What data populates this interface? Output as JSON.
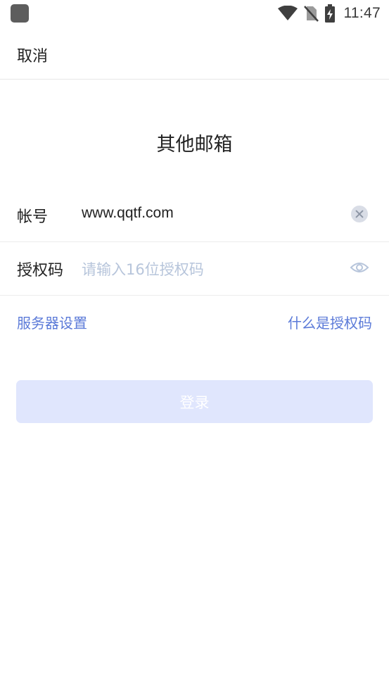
{
  "status_bar": {
    "time": "11:47",
    "icons": [
      "app-badge",
      "wifi-icon",
      "no-sim-icon",
      "battery-charging-icon"
    ]
  },
  "topbar": {
    "cancel_label": "取消"
  },
  "page_title": "其他邮箱",
  "account": {
    "label": "帐号",
    "value": "www.qqtf.com"
  },
  "auth_code": {
    "label": "授权码",
    "placeholder": "请输入16位授权码"
  },
  "links": {
    "server_settings": "服务器设置",
    "what_is_auth_code": "什么是授权码"
  },
  "login_button": {
    "label": "登录",
    "state": "disabled"
  },
  "colors": {
    "link": "#5b7ad8",
    "button_disabled_bg": "#e0e6fd",
    "placeholder": "#b7c5db"
  }
}
